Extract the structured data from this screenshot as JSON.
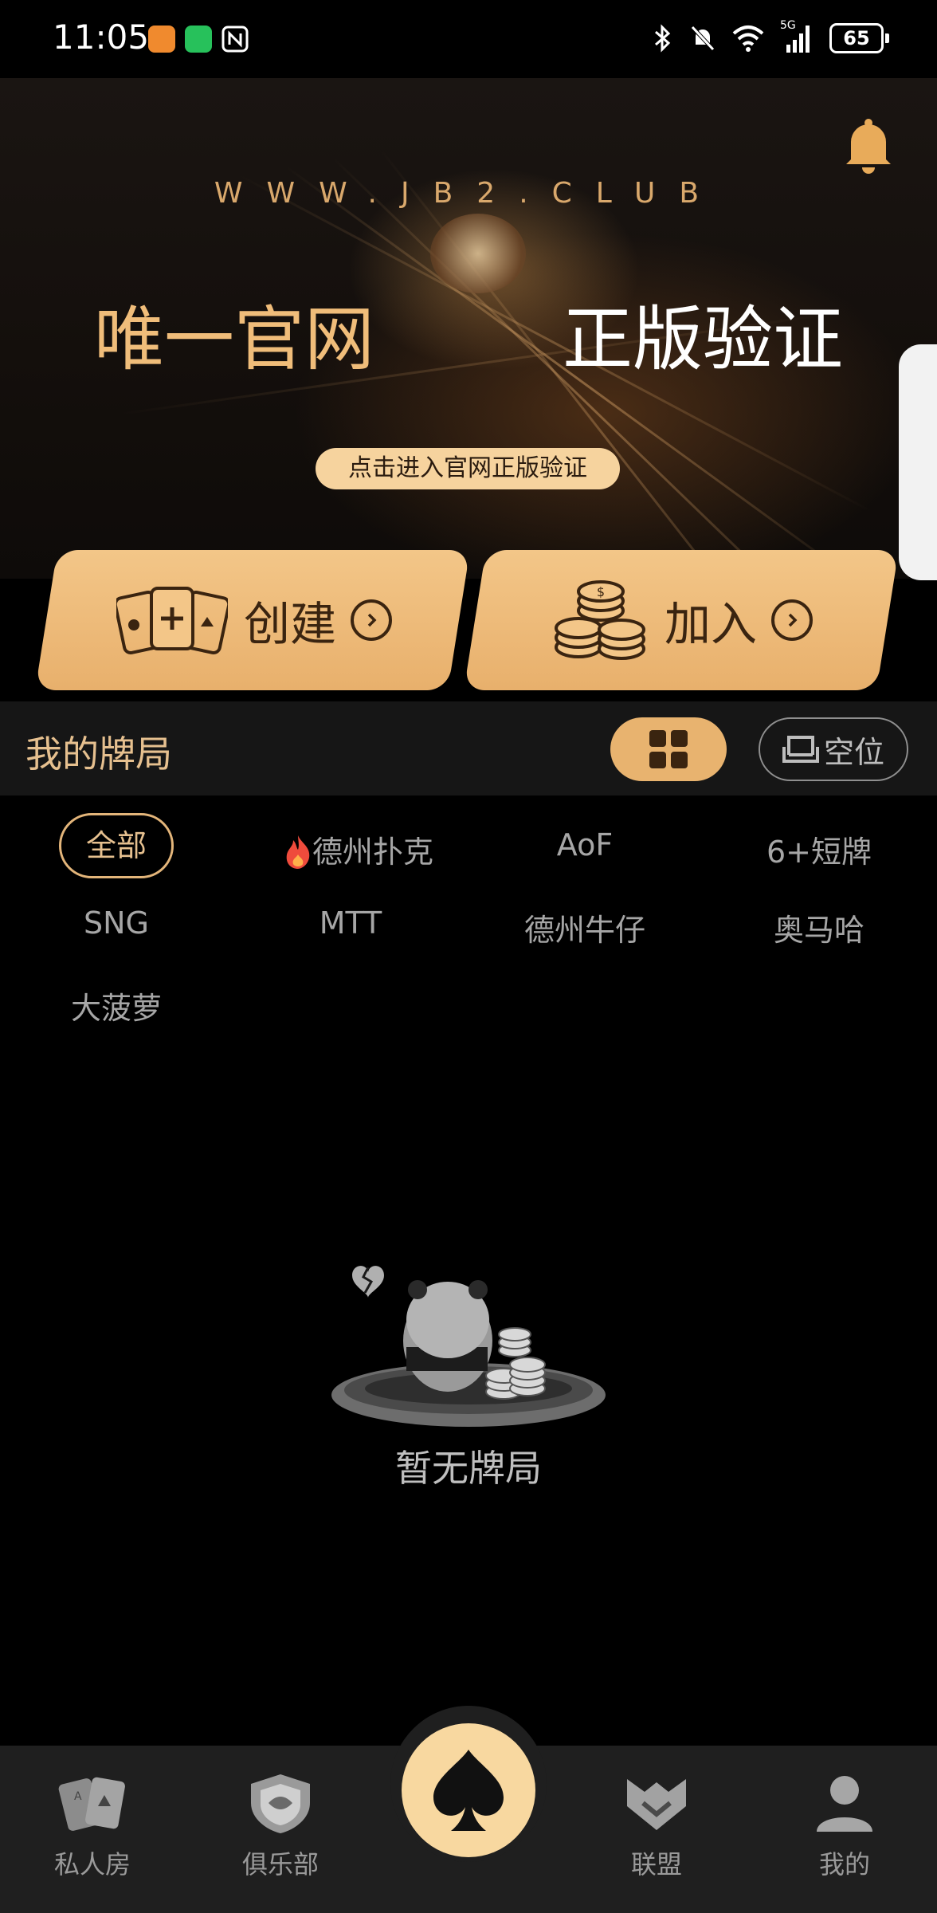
{
  "status_bar": {
    "time": "11:05",
    "battery": "65",
    "network": "5G",
    "icons": [
      "app-orange-icon",
      "wechat-icon",
      "nfc-icon",
      "bluetooth-icon",
      "mute-bell-icon",
      "wifi-icon",
      "signal-icon",
      "battery-icon"
    ]
  },
  "banner": {
    "url_text": "WWW.JB2.CLUB",
    "slogan_left": "唯一官网",
    "slogan_right": "正版验证",
    "verify_button": "点击进入官网正版验证"
  },
  "actions": {
    "create": "创建",
    "join": "加入"
  },
  "my_games": {
    "title": "我的牌局",
    "seat_button": "空位"
  },
  "filters": {
    "all": "全部",
    "texas": "德州扑克",
    "aof": "AoF",
    "short": "6+短牌",
    "sng": "SNG",
    "mtt": "MTT",
    "cowboy": "德州牛仔",
    "omaha": "奥马哈",
    "pineapple": "大菠萝"
  },
  "empty_state": {
    "text": "暂无牌局"
  },
  "bottom_nav": {
    "private_room": "私人房",
    "club": "俱乐部",
    "league": "联盟",
    "mine": "我的"
  },
  "colors": {
    "accent_gold": "#e8b36f",
    "pill_bg": "#f6d39e",
    "background": "#000000"
  }
}
